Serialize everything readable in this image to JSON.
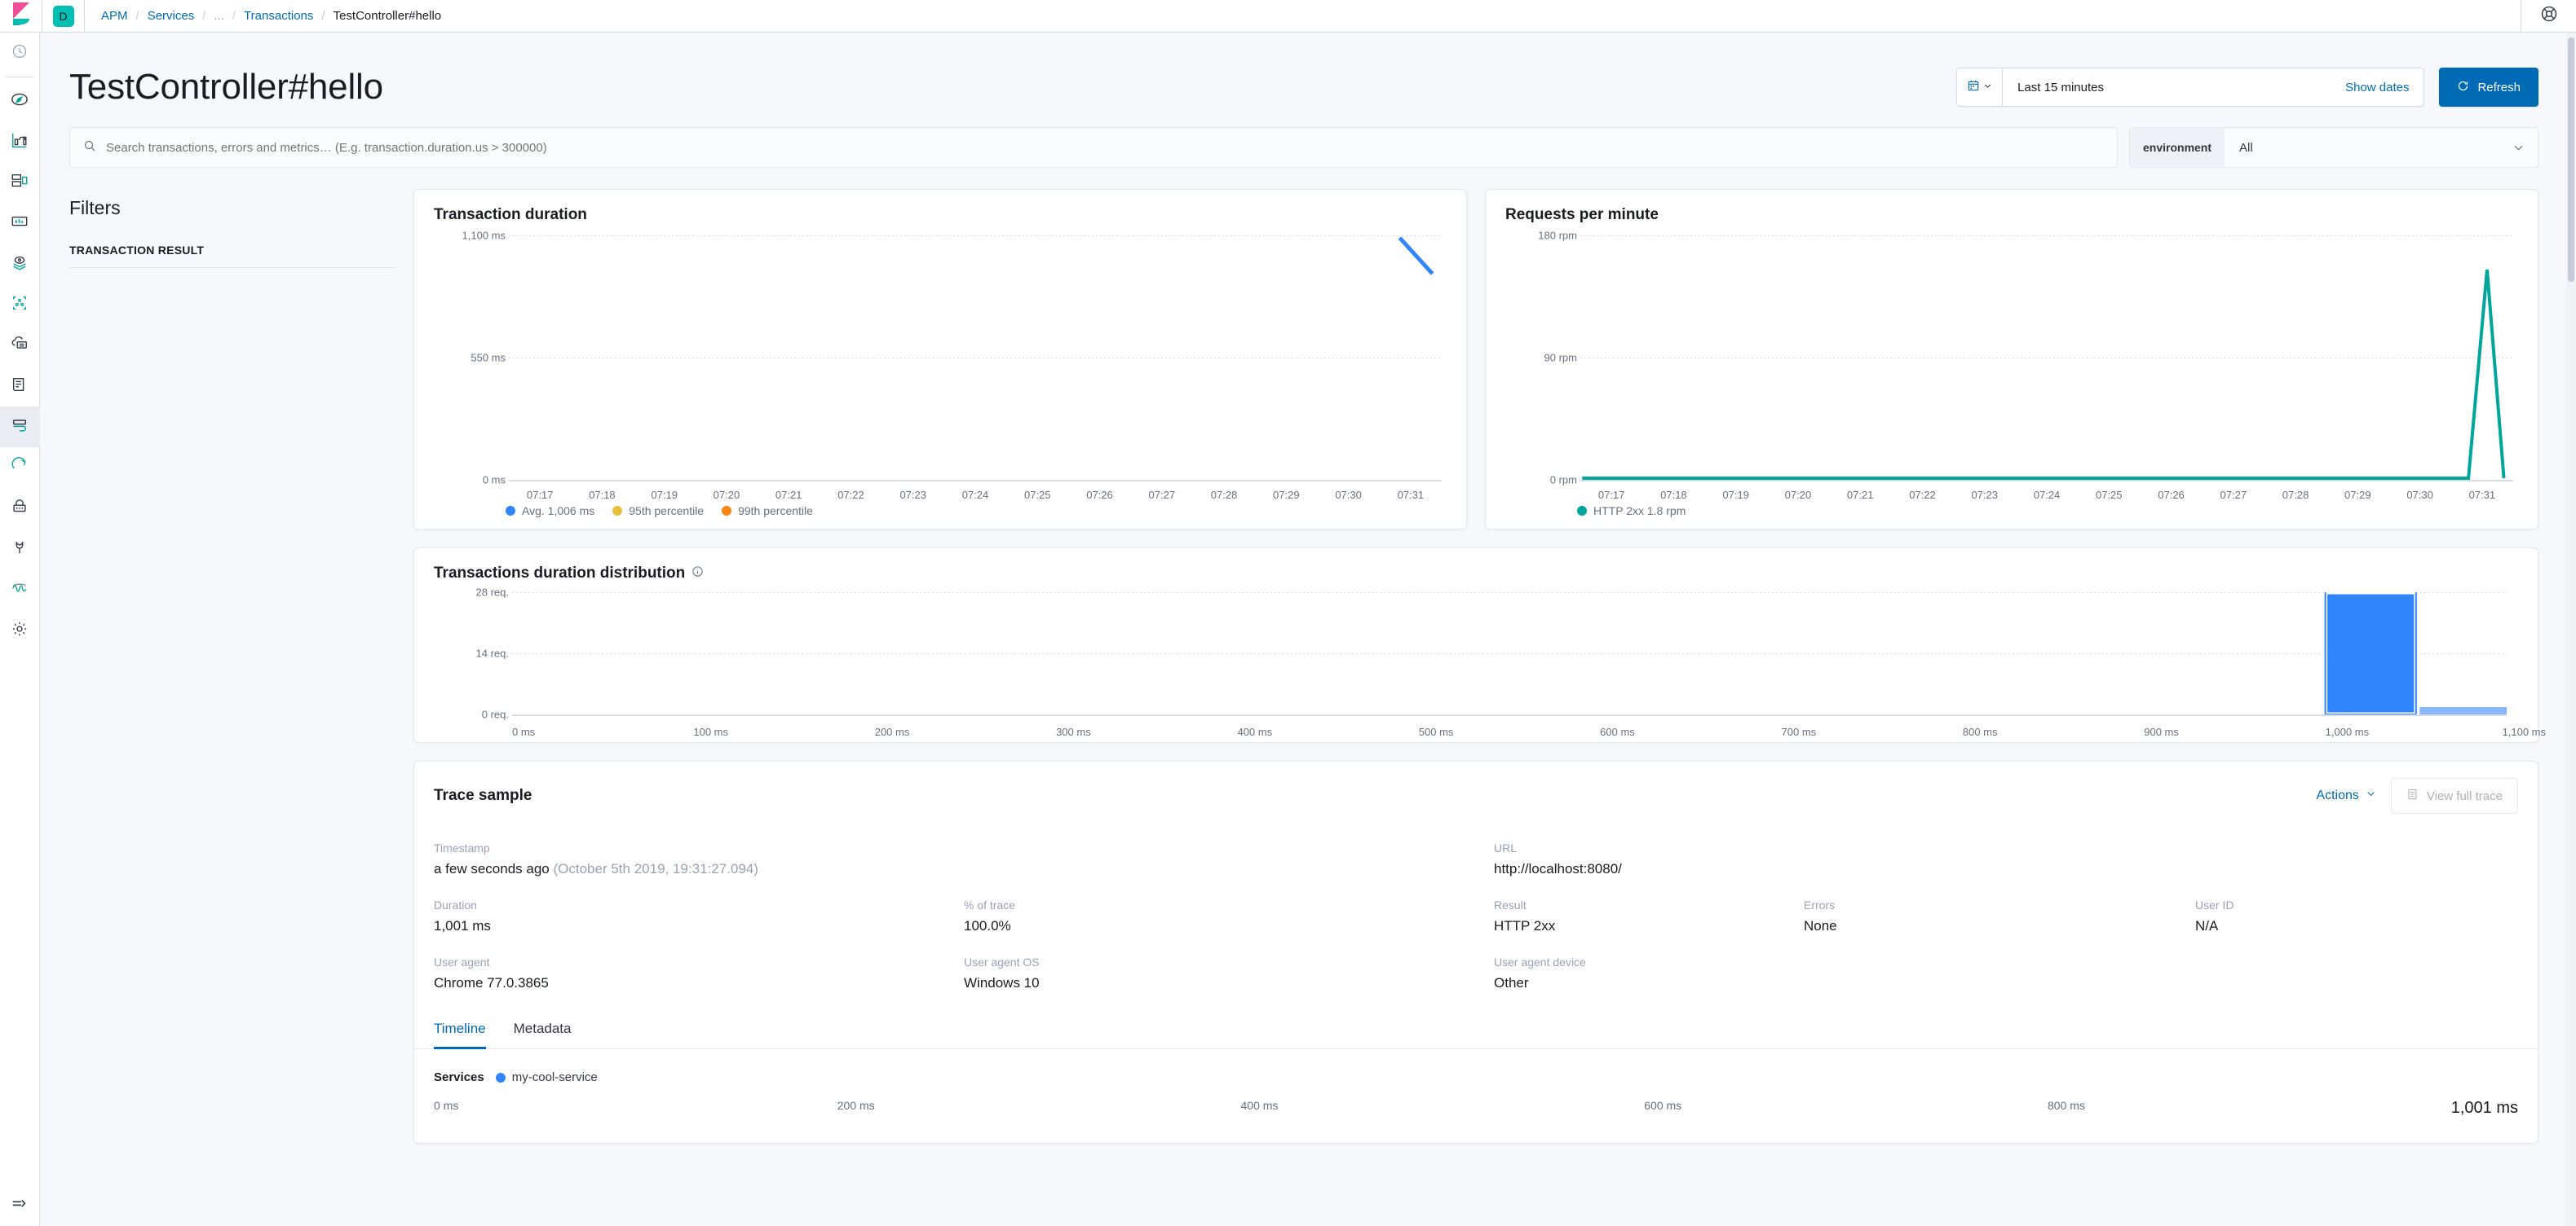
{
  "app": {
    "logo_name": "kibana-logo",
    "space_initial": "D",
    "help_icon": "help-lifebuoy-icon",
    "collapse_icon": "collapse-nav-icon"
  },
  "breadcrumbs": [
    {
      "label": "APM",
      "style": "link"
    },
    {
      "label": "Services",
      "style": "link"
    },
    {
      "label": "...",
      "style": "muted"
    },
    {
      "label": "Transactions",
      "style": "link"
    },
    {
      "label": "TestController#hello",
      "style": "current"
    }
  ],
  "nav": {
    "items": [
      {
        "name": "recently-viewed-icon",
        "label": "Recently viewed"
      },
      {
        "name": "discover-icon",
        "label": "Discover"
      },
      {
        "name": "visualize-icon",
        "label": "Visualize"
      },
      {
        "name": "dashboard-icon",
        "label": "Dashboard"
      },
      {
        "name": "canvas-icon",
        "label": "Canvas"
      },
      {
        "name": "maps-icon",
        "label": "Maps"
      },
      {
        "name": "machine-learning-icon",
        "label": "Machine Learning"
      },
      {
        "name": "infrastructure-icon",
        "label": "Infrastructure"
      },
      {
        "name": "logs-icon",
        "label": "Logs"
      },
      {
        "name": "apm-icon",
        "label": "APM",
        "active": true
      },
      {
        "name": "uptime-icon",
        "label": "Uptime"
      },
      {
        "name": "siem-icon",
        "label": "SIEM"
      },
      {
        "name": "dev-tools-icon",
        "label": "Dev Tools"
      },
      {
        "name": "monitoring-icon",
        "label": "Monitoring"
      },
      {
        "name": "management-icon",
        "label": "Management"
      }
    ]
  },
  "header": {
    "title": "TestController#hello",
    "time_picker": {
      "calendar_icon": "calendar-icon",
      "caret_icon": "chevron-down-icon",
      "range_label": "Last 15 minutes",
      "show_dates_label": "Show dates"
    },
    "refresh_label": "Refresh",
    "refresh_icon": "refresh-icon",
    "refresh_color": "#006bb4"
  },
  "search": {
    "icon": "search-icon",
    "value": "",
    "placeholder": "Search transactions, errors and metrics… (E.g. transaction.duration.us > 300000)"
  },
  "environment": {
    "prepend_label": "environment",
    "selected": "All",
    "caret_icon": "chevron-down-icon"
  },
  "filters": {
    "title": "Filters",
    "group_label": "TRANSACTION RESULT"
  },
  "chart_data": [
    {
      "type": "line",
      "title": "Transaction duration",
      "xlabel": "",
      "ylabel": "",
      "grid": true,
      "legend_position": "bottom",
      "ytick_labels": [
        "1,100 ms",
        "550 ms",
        "0 ms"
      ],
      "ylim": [
        0,
        1100
      ],
      "yticks": [
        1100,
        550,
        0
      ],
      "x": [
        "07:17",
        "07:18",
        "07:19",
        "07:20",
        "07:21",
        "07:22",
        "07:23",
        "07:24",
        "07:25",
        "07:26",
        "07:27",
        "07:28",
        "07:29",
        "07:30",
        "07:31"
      ],
      "series": [
        {
          "name": "Avg. 1,006 ms",
          "color": "#3185fc",
          "points": [
            {
              "x": "07:31",
              "y": 1090
            },
            {
              "x": "07:31.5",
              "y": 930
            }
          ]
        },
        {
          "name": "95th percentile",
          "color": "#e7c037",
          "points": []
        },
        {
          "name": "99th percentile",
          "color": "#f98510",
          "points": []
        }
      ]
    },
    {
      "type": "line",
      "title": "Requests per minute",
      "xlabel": "",
      "ylabel": "",
      "grid": true,
      "legend_position": "bottom",
      "ytick_labels": [
        "180 rpm",
        "90 rpm",
        "0 rpm"
      ],
      "ylim": [
        0,
        180
      ],
      "yticks": [
        180,
        90,
        0
      ],
      "x": [
        "07:17",
        "07:18",
        "07:19",
        "07:20",
        "07:21",
        "07:22",
        "07:23",
        "07:24",
        "07:25",
        "07:26",
        "07:27",
        "07:28",
        "07:29",
        "07:30",
        "07:31"
      ],
      "series": [
        {
          "name": "HTTP 2xx 1.8 rpm",
          "color": "#00a69b",
          "points": [
            {
              "x": "07:17",
              "y": 0
            },
            {
              "x": "07:30.7",
              "y": 0
            },
            {
              "x": "07:31.0",
              "y": 155
            },
            {
              "x": "07:31.3",
              "y": 0
            }
          ]
        }
      ]
    },
    {
      "type": "bar",
      "title": "Transactions duration distribution",
      "info_icon": "info-circle-icon",
      "xlabel": "",
      "ylabel": "",
      "grid": true,
      "ytick_labels": [
        "28 req.",
        "14 req.",
        "0 req."
      ],
      "ylim": [
        0,
        28
      ],
      "yticks": [
        28,
        14,
        0
      ],
      "xtick_labels": [
        "0 ms",
        "100 ms",
        "200 ms",
        "300 ms",
        "400 ms",
        "500 ms",
        "600 ms",
        "700 ms",
        "800 ms",
        "900 ms",
        "1,000 ms",
        "1,100 ms"
      ],
      "xlim": [
        0,
        1100
      ],
      "bar_color": "#3185fc",
      "bar_color_faded": "#8ab9fb",
      "bars": [
        {
          "x0": 1000,
          "x1": 1050,
          "value": 28,
          "selected": true
        },
        {
          "x0": 1050,
          "x1": 1100,
          "value": 0.7,
          "selected": false
        }
      ]
    }
  ],
  "trace_sample": {
    "title": "Trace sample",
    "actions_label": "Actions",
    "actions_caret_icon": "chevron-down-icon",
    "view_full_trace_label": "View full trace",
    "view_full_trace_icon": "document-icon",
    "fields": [
      {
        "label": "Timestamp",
        "value": "a few seconds ago",
        "suffix": "(October 5th 2019, 19:31:27.094)"
      },
      {
        "label": "URL",
        "value": "http://localhost:8080/"
      },
      {
        "label": "Duration",
        "value": "1,001 ms"
      },
      {
        "label": "% of trace",
        "value": "100.0%"
      },
      {
        "label": "Result",
        "value": "HTTP 2xx"
      },
      {
        "label": "Errors",
        "value": "None"
      },
      {
        "label": "User ID",
        "value": "N/A"
      },
      {
        "label": "User agent",
        "value": "Chrome 77.0.3865"
      },
      {
        "label": "User agent OS",
        "value": "Windows 10"
      },
      {
        "label": "User agent device",
        "value": "Other"
      }
    ],
    "tabs": [
      {
        "label": "Timeline",
        "active": true
      },
      {
        "label": "Metadata",
        "active": false
      }
    ],
    "timeline": {
      "services_label": "Services",
      "service_name": "my-cool-service",
      "service_color": "#3185fc",
      "axis_labels": [
        "0 ms",
        "200 ms",
        "400 ms",
        "600 ms",
        "800 ms"
      ],
      "axis_end_label": "1,001 ms"
    }
  }
}
